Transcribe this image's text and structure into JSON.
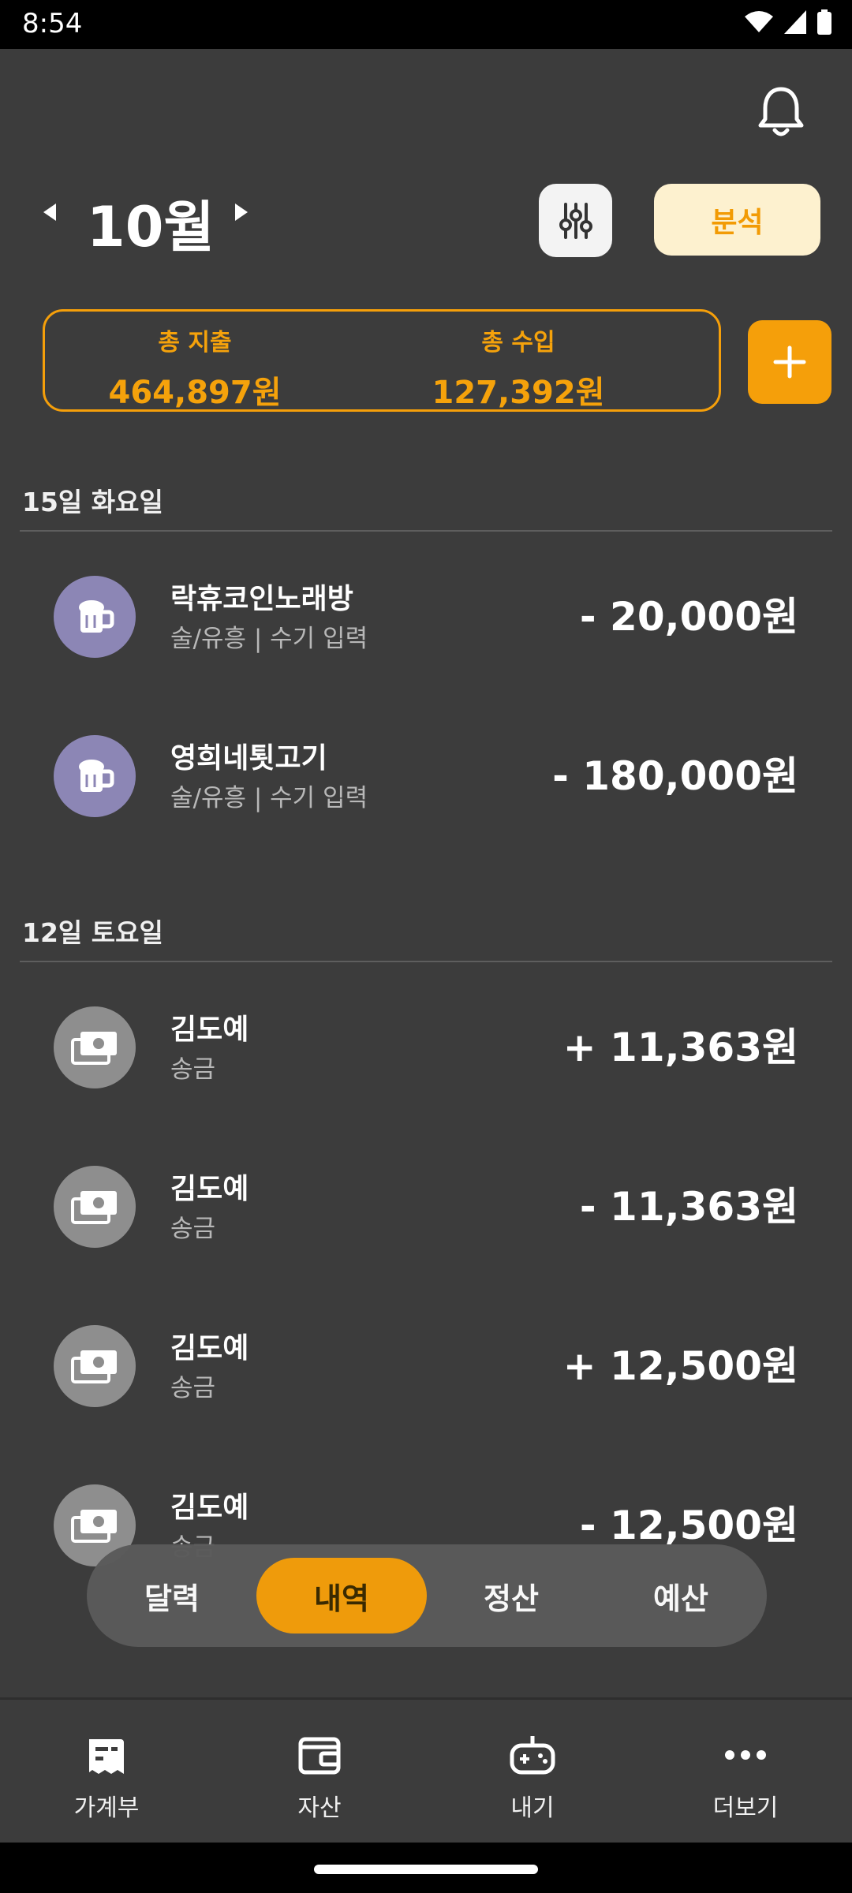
{
  "status_bar": {
    "time": "8:54"
  },
  "header": {
    "month": "10월",
    "analysis_label": "분석",
    "total_expense_label": "총 지출",
    "total_expense_value": "464,897원",
    "total_income_label": "총 수입",
    "total_income_value": "127,392원"
  },
  "days": [
    {
      "title": "15일 화요일",
      "transactions": [
        {
          "name": "락휴코인노래방",
          "sub": "술/유흥 | 수기 입력",
          "amount": "- 20,000원",
          "icon": "beer-icon"
        },
        {
          "name": "영희네툇고기",
          "sub": "술/유흥 | 수기 입력",
          "amount": "- 180,000원",
          "icon": "beer-icon"
        }
      ]
    },
    {
      "title": "12일 토요일",
      "transactions": [
        {
          "name": "김도예",
          "sub": "송금",
          "amount": "+ 11,363원",
          "icon": "cash-icon"
        },
        {
          "name": "김도예",
          "sub": "송금",
          "amount": "- 11,363원",
          "icon": "cash-icon"
        },
        {
          "name": "김도예",
          "sub": "송금",
          "amount": "+ 12,500원",
          "icon": "cash-icon"
        },
        {
          "name": "김도예",
          "sub": "송금",
          "amount": "- 12,500원",
          "icon": "cash-icon"
        }
      ]
    }
  ],
  "segment_tabs": [
    "달력",
    "내역",
    "정산",
    "예산"
  ],
  "segment_active": "내역",
  "bottom_nav": [
    {
      "label": "가계부",
      "icon": "ledger-icon"
    },
    {
      "label": "자산",
      "icon": "wallet-icon"
    },
    {
      "label": "내기",
      "icon": "gamepad-icon"
    },
    {
      "label": "더보기",
      "icon": "more-icon"
    }
  ],
  "colors": {
    "accent": "#f59f0a",
    "background": "#3c3c3c",
    "category_purple": "#8c86b5"
  }
}
